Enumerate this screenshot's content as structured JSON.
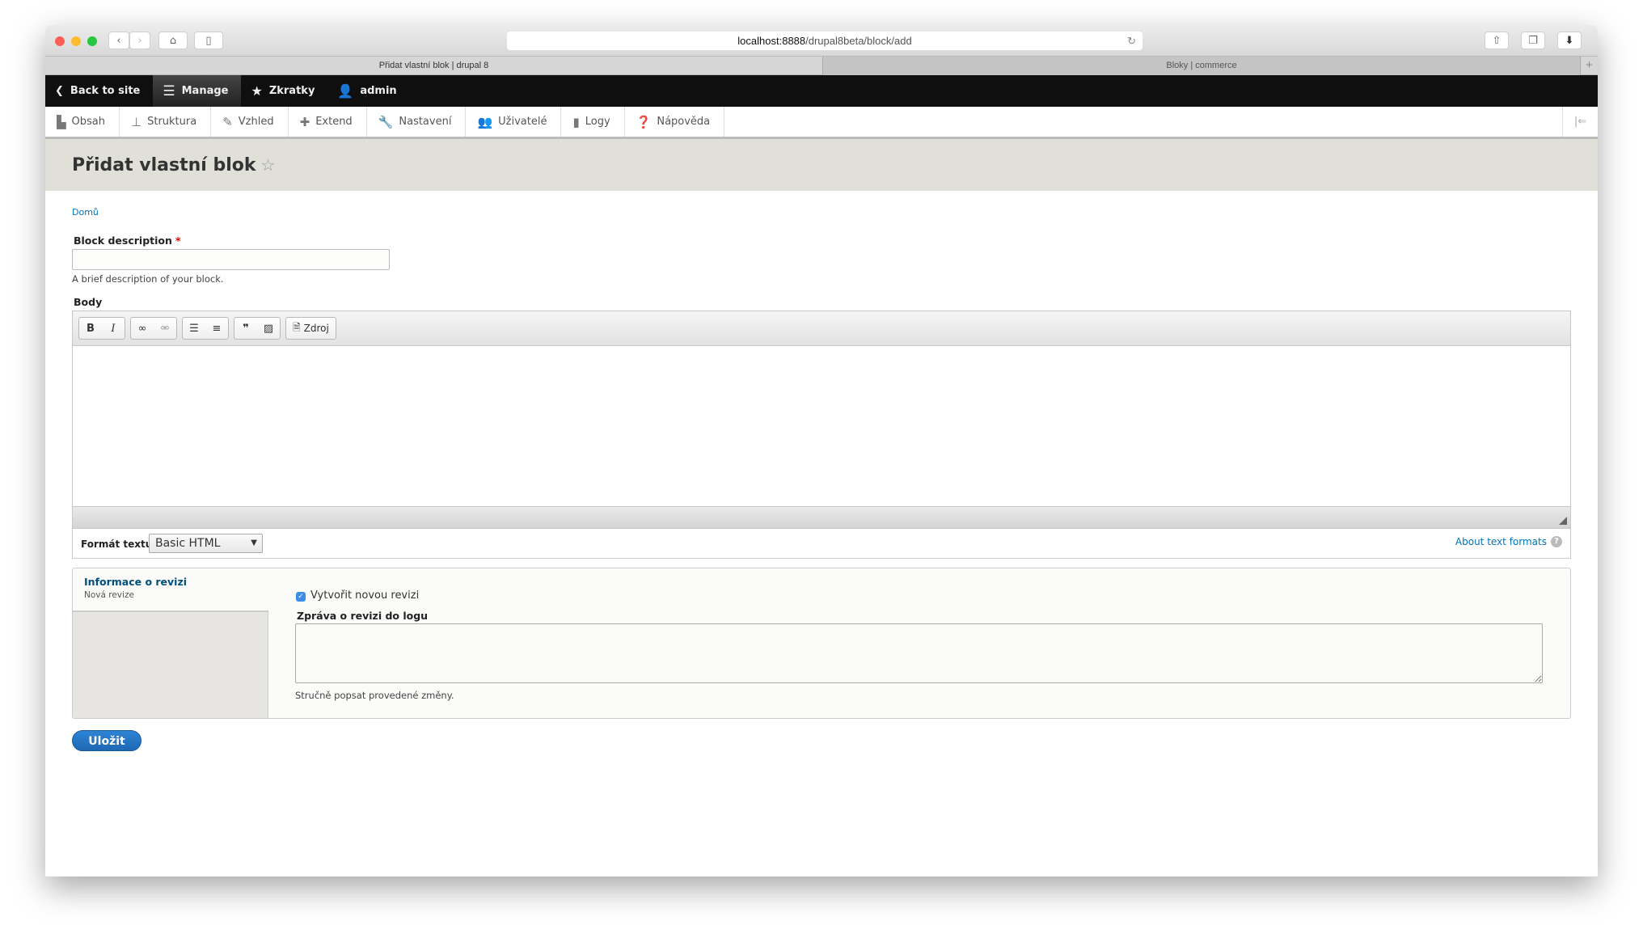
{
  "browser": {
    "url_host": "localhost:8888",
    "url_path": "/drupal8beta/block/add",
    "tabs": [
      {
        "label": "Přidat vlastní blok | drupal 8",
        "active": true
      },
      {
        "label": "Bloky | commerce",
        "active": false
      }
    ],
    "new_tab": "+"
  },
  "toolbar": {
    "back": "Back to site",
    "manage": "Manage",
    "shortcuts": "Zkratky",
    "user": "admin"
  },
  "tray": [
    {
      "label": "Obsah",
      "icon": "file-icon"
    },
    {
      "label": "Struktura",
      "icon": "sitemap-icon"
    },
    {
      "label": "Vzhled",
      "icon": "brush-icon"
    },
    {
      "label": "Extend",
      "icon": "puzzle-icon"
    },
    {
      "label": "Nastavení",
      "icon": "wrench-icon"
    },
    {
      "label": "Uživatelé",
      "icon": "users-icon"
    },
    {
      "label": "Logy",
      "icon": "chart-icon"
    },
    {
      "label": "Nápověda",
      "icon": "help-icon"
    }
  ],
  "page": {
    "title": "Přidat vlastní blok",
    "breadcrumb": "Domů"
  },
  "form": {
    "block_description_label": "Block description",
    "required_mark": "*",
    "block_description_value": "",
    "block_description_help": "A brief description of your block.",
    "body_label": "Body",
    "source_label": "Zdroj",
    "format_label": "Formát textu",
    "format_value": "Basic HTML",
    "about_formats": "About text formats",
    "revision": {
      "title": "Informace o revizi",
      "summary": "Nová revize",
      "checkbox_label": "Vytvořit novou revizi",
      "checked": true,
      "log_label": "Zpráva o revizi do logu",
      "log_value": "",
      "log_help": "Stručně popsat provedené změny."
    },
    "save": "Uložit"
  },
  "colors": {
    "accent": "#0074bd",
    "button": "#2574c4",
    "toolbar": "#0f0f0f",
    "header": "#e0e0d8"
  }
}
